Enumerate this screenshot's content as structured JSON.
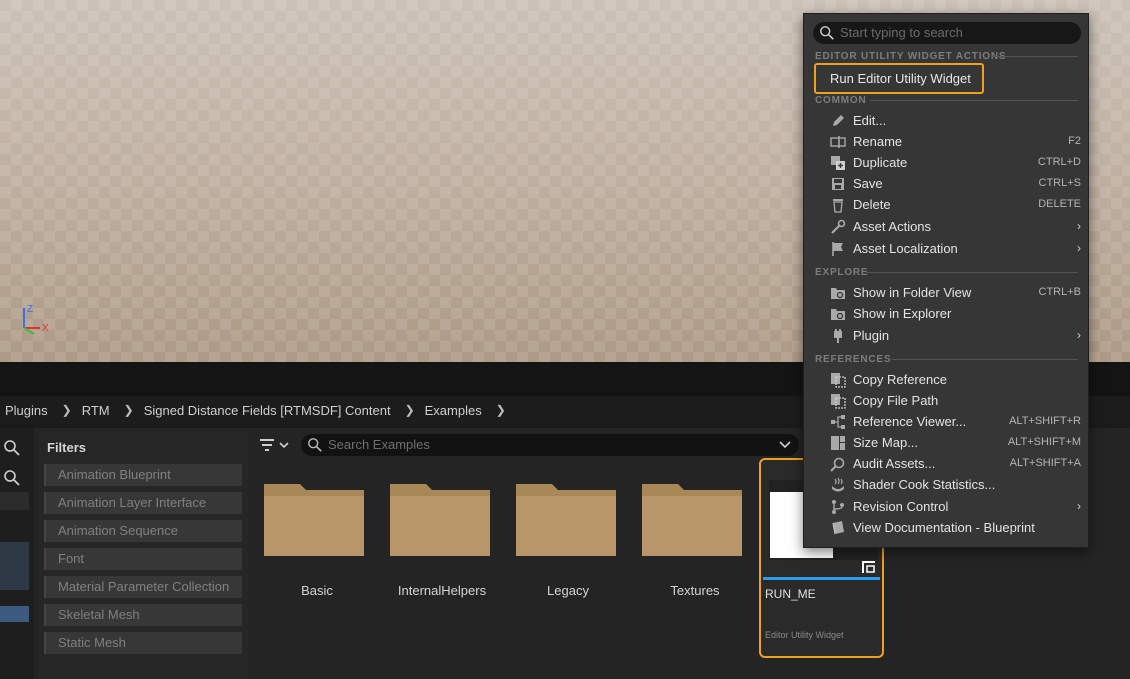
{
  "viewport": {
    "gizmo": {
      "z": "Z",
      "x": "X"
    }
  },
  "breadcrumb": {
    "items": [
      "Plugins",
      "RTM",
      "Signed Distance Fields [RTMSDF] Content",
      "Examples"
    ]
  },
  "filters": {
    "title": "Filters",
    "items": [
      "Animation Blueprint",
      "Animation Layer Interface",
      "Animation Sequence",
      "Font",
      "Material Parameter Collection",
      "Skeletal Mesh",
      "Static Mesh"
    ]
  },
  "search": {
    "placeholder": "Search Examples"
  },
  "assets": [
    {
      "name": "Basic",
      "type": "folder"
    },
    {
      "name": "InternalHelpers",
      "type": "folder"
    },
    {
      "name": "Legacy",
      "type": "folder"
    },
    {
      "name": "Textures",
      "type": "folder"
    },
    {
      "name": "RUN_ME",
      "type": "Editor Utility Widget"
    }
  ],
  "context_menu": {
    "search_placeholder": "Start typing to search",
    "sections": {
      "editor_utility": "EDITOR UTILITY WIDGET ACTIONS",
      "common": "COMMON",
      "explore": "EXPLORE",
      "references": "REFERENCES"
    },
    "run_label": "Run Editor Utility Widget",
    "common_items": [
      {
        "label": "Edit...",
        "shortcut": "",
        "icon": "pencil-icon"
      },
      {
        "label": "Rename",
        "shortcut": "F2",
        "icon": "rename-icon"
      },
      {
        "label": "Duplicate",
        "shortcut": "CTRL+D",
        "icon": "duplicate-icon"
      },
      {
        "label": "Save",
        "shortcut": "CTRL+S",
        "icon": "save-icon"
      },
      {
        "label": "Delete",
        "shortcut": "DELETE",
        "icon": "trash-icon"
      },
      {
        "label": "Asset Actions",
        "shortcut": "",
        "icon": "wrench-icon",
        "submenu": true
      },
      {
        "label": "Asset Localization",
        "shortcut": "",
        "icon": "flag-icon",
        "submenu": true
      }
    ],
    "explore_items": [
      {
        "label": "Show in Folder View",
        "shortcut": "CTRL+B",
        "icon": "folder-search-icon"
      },
      {
        "label": "Show in Explorer",
        "shortcut": "",
        "icon": "folder-search-icon"
      },
      {
        "label": "Plugin",
        "shortcut": "",
        "icon": "plugin-icon",
        "submenu": true
      }
    ],
    "reference_items": [
      {
        "label": "Copy Reference",
        "shortcut": "",
        "icon": "copy-icon"
      },
      {
        "label": "Copy File Path",
        "shortcut": "",
        "icon": "copy-icon"
      },
      {
        "label": "Reference Viewer...",
        "shortcut": "ALT+SHIFT+R",
        "icon": "graph-icon"
      },
      {
        "label": "Size Map...",
        "shortcut": "ALT+SHIFT+M",
        "icon": "sizemap-icon"
      },
      {
        "label": "Audit Assets...",
        "shortcut": "ALT+SHIFT+A",
        "icon": "audit-icon"
      },
      {
        "label": "Shader Cook Statistics...",
        "shortcut": "",
        "icon": "shader-icon"
      },
      {
        "label": "Revision Control",
        "shortcut": "",
        "icon": "branch-icon",
        "submenu": true
      },
      {
        "label": "View Documentation - Blueprint",
        "shortcut": "",
        "icon": "book-icon"
      }
    ],
    "submenu_arrow": "›"
  }
}
